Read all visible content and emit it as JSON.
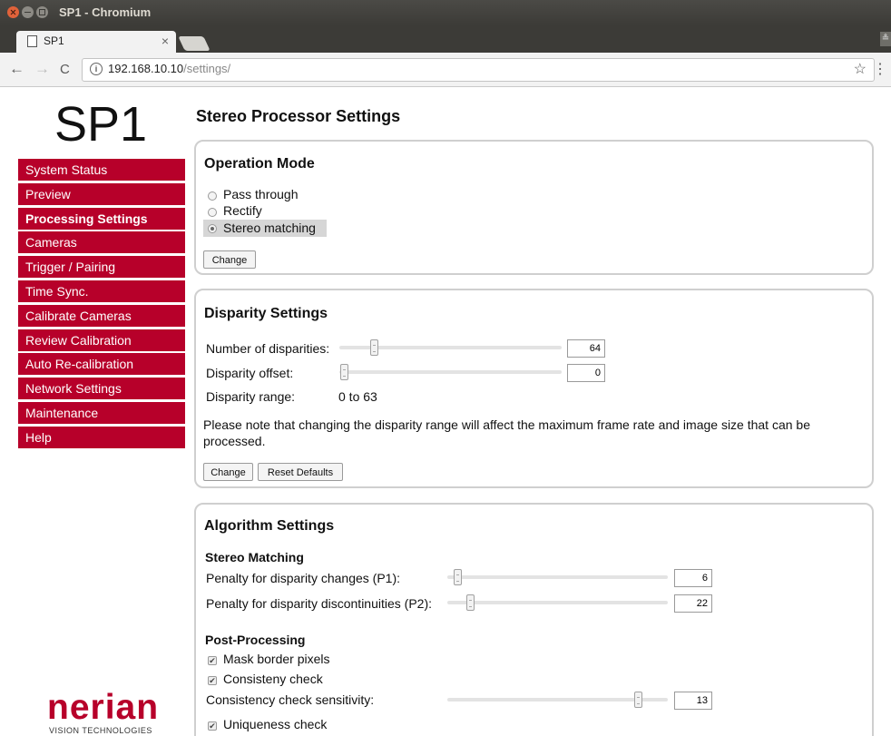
{
  "window": {
    "title": "SP1 - Chromium"
  },
  "tab": {
    "title": "SP1",
    "close": "×"
  },
  "address": {
    "host": "192.168.10.10",
    "path": "/settings/"
  },
  "icons": {
    "back": "←",
    "forward": "→",
    "reload": "C",
    "info": "i",
    "star": "☆",
    "menu": "⋮",
    "check": "✔",
    "profile": "≗"
  },
  "sidebar": {
    "logo": "SP1",
    "items": [
      {
        "label": "System Status"
      },
      {
        "label": "Preview"
      },
      {
        "label": "Processing Settings"
      },
      {
        "label": "Cameras"
      },
      {
        "label": "Trigger / Pairing"
      },
      {
        "label": "Time Sync."
      },
      {
        "label": "Calibrate Cameras"
      },
      {
        "label": "Review Calibration"
      },
      {
        "label": "Auto Re-calibration"
      },
      {
        "label": "Network Settings"
      },
      {
        "label": "Maintenance"
      },
      {
        "label": "Help"
      }
    ],
    "active_index": 2,
    "brand": {
      "name": "nerian",
      "tagline": "VISION TECHNOLOGIES"
    }
  },
  "main": {
    "title": "Stereo Processor Settings",
    "operation": {
      "heading": "Operation Mode",
      "options": [
        "Pass through",
        "Rectify",
        "Stereo matching"
      ],
      "selected": "Stereo matching",
      "change_label": "Change"
    },
    "disparity": {
      "heading": "Disparity Settings",
      "num_label": "Number of disparities:",
      "num_value": "64",
      "offset_label": "Disparity offset:",
      "offset_value": "0",
      "range_label": "Disparity range:",
      "range_value": "0 to 63",
      "note": "Please note that changing the disparity range will affect the maximum frame rate and image size that can be processed.",
      "change_label": "Change",
      "reset_label": "Reset Defaults"
    },
    "algorithm": {
      "heading": "Algorithm Settings",
      "stereo_heading": "Stereo Matching",
      "p1_label": "Penalty for disparity changes (P1):",
      "p1_value": "6",
      "p2_label": "Penalty for disparity discontinuities (P2):",
      "p2_value": "22",
      "post_heading": "Post-Processing",
      "mask_label": "Mask border pixels",
      "mask_checked": true,
      "consistency_label": "Consisteny check",
      "consistency_checked": true,
      "sensitivity_label": "Consistency check sensitivity:",
      "sensitivity_value": "13",
      "uniqueness_label": "Uniqueness check",
      "uniqueness_checked": true
    }
  }
}
